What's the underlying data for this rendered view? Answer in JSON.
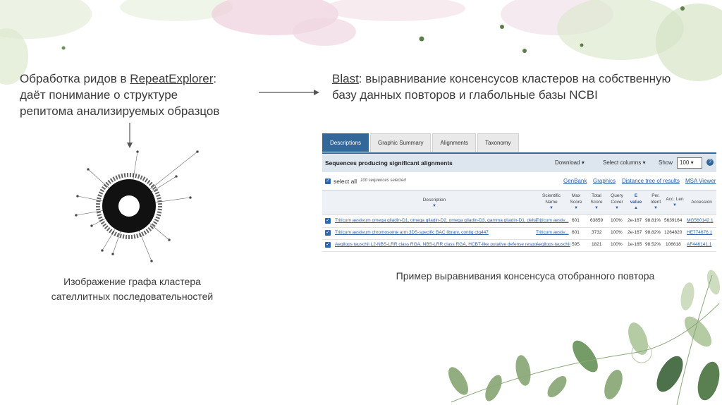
{
  "left": {
    "line1_prefix": "Обработка ридов в ",
    "line1_link": "RepeatExplorer",
    "line1_suffix": ":",
    "line2": "даёт понимание о структуре",
    "line3": "репитома анализируемых образцов"
  },
  "right": {
    "line1_link": "Blast",
    "line1_rest": ": выравнивание консенсусов кластеров на собственную",
    "line2": "базу данных повторов и глабольные базы NCBI"
  },
  "caption_left": {
    "line1": "Изображение графа кластера",
    "line2": "сателлитных последовательностей"
  },
  "caption_right": "Пример выравнивания консенсуса отобранного повтора",
  "blast": {
    "tabs": [
      "Descriptions",
      "Graphic Summary",
      "Alignments",
      "Taxonomy"
    ],
    "section_title": "Sequences producing significant alignments",
    "download_label": "Download",
    "select_columns_label": "Select columns",
    "show_label": "Show",
    "show_value": "100",
    "help_label": "?",
    "select_all_label": "select all",
    "selected_count": "100 sequences selected",
    "links": [
      "GenBank",
      "Graphics",
      "Distance tree of results",
      "MSA Viewer"
    ],
    "headers": {
      "description": "Description",
      "sci_name": [
        "Scientific",
        "Name"
      ],
      "max_score": [
        "Max",
        "Score"
      ],
      "total_score": [
        "Total",
        "Score"
      ],
      "query_cover": [
        "Query",
        "Cover"
      ],
      "e_value": [
        "E",
        "value"
      ],
      "per_ident": [
        "Per.",
        "Ident"
      ],
      "acc_len": "Acc. Len",
      "accession": "Accession"
    },
    "rows": [
      {
        "description": "Triticum aestivum omega gliadin-D1, omega gliadin-D2, omega gliadin-D3, gamma gliadin-D1, delta ...",
        "sci_name": "Triticum aestiv...",
        "max_score": "601",
        "total_score": "63859",
        "query_cover": "100%",
        "e_value": "2e-167",
        "per_ident": "98.81%",
        "acc_len": "5639164",
        "accession": "MG560142.1"
      },
      {
        "description": "Triticum aestivum chromosome arm 3DS-specific BAC library, contig ctg447",
        "sci_name": "Triticum aestiv...",
        "max_score": "601",
        "total_score": "3732",
        "query_cover": "100%",
        "e_value": "2e-167",
        "per_ident": "98.82%",
        "acc_len": "1264820",
        "accession": "HE774676.1"
      },
      {
        "description": "Aegilops tauschii L2-NBS-LRR class RGA, NBS-LRR class RGA, HCBT-like putative defense respo...",
        "sci_name": "Aegilops tauschii",
        "max_score": "595",
        "total_score": "1821",
        "query_cover": "100%",
        "e_value": "1e-165",
        "per_ident": "98.52%",
        "acc_len": "106618",
        "accession": "AF446141.1"
      }
    ]
  },
  "colors": {
    "text": "#3a3a3a",
    "ncbi_blue": "#336699",
    "link_blue": "#2c5fa8",
    "leaf_green": "#5f8a4a",
    "watercolor_pink": "#e9c6d6",
    "watercolor_green": "#d9e6c8"
  },
  "icons": [
    "cluster-graph-image",
    "arrow-right-icon",
    "arrow-down-icon",
    "leaf-decoration"
  ]
}
